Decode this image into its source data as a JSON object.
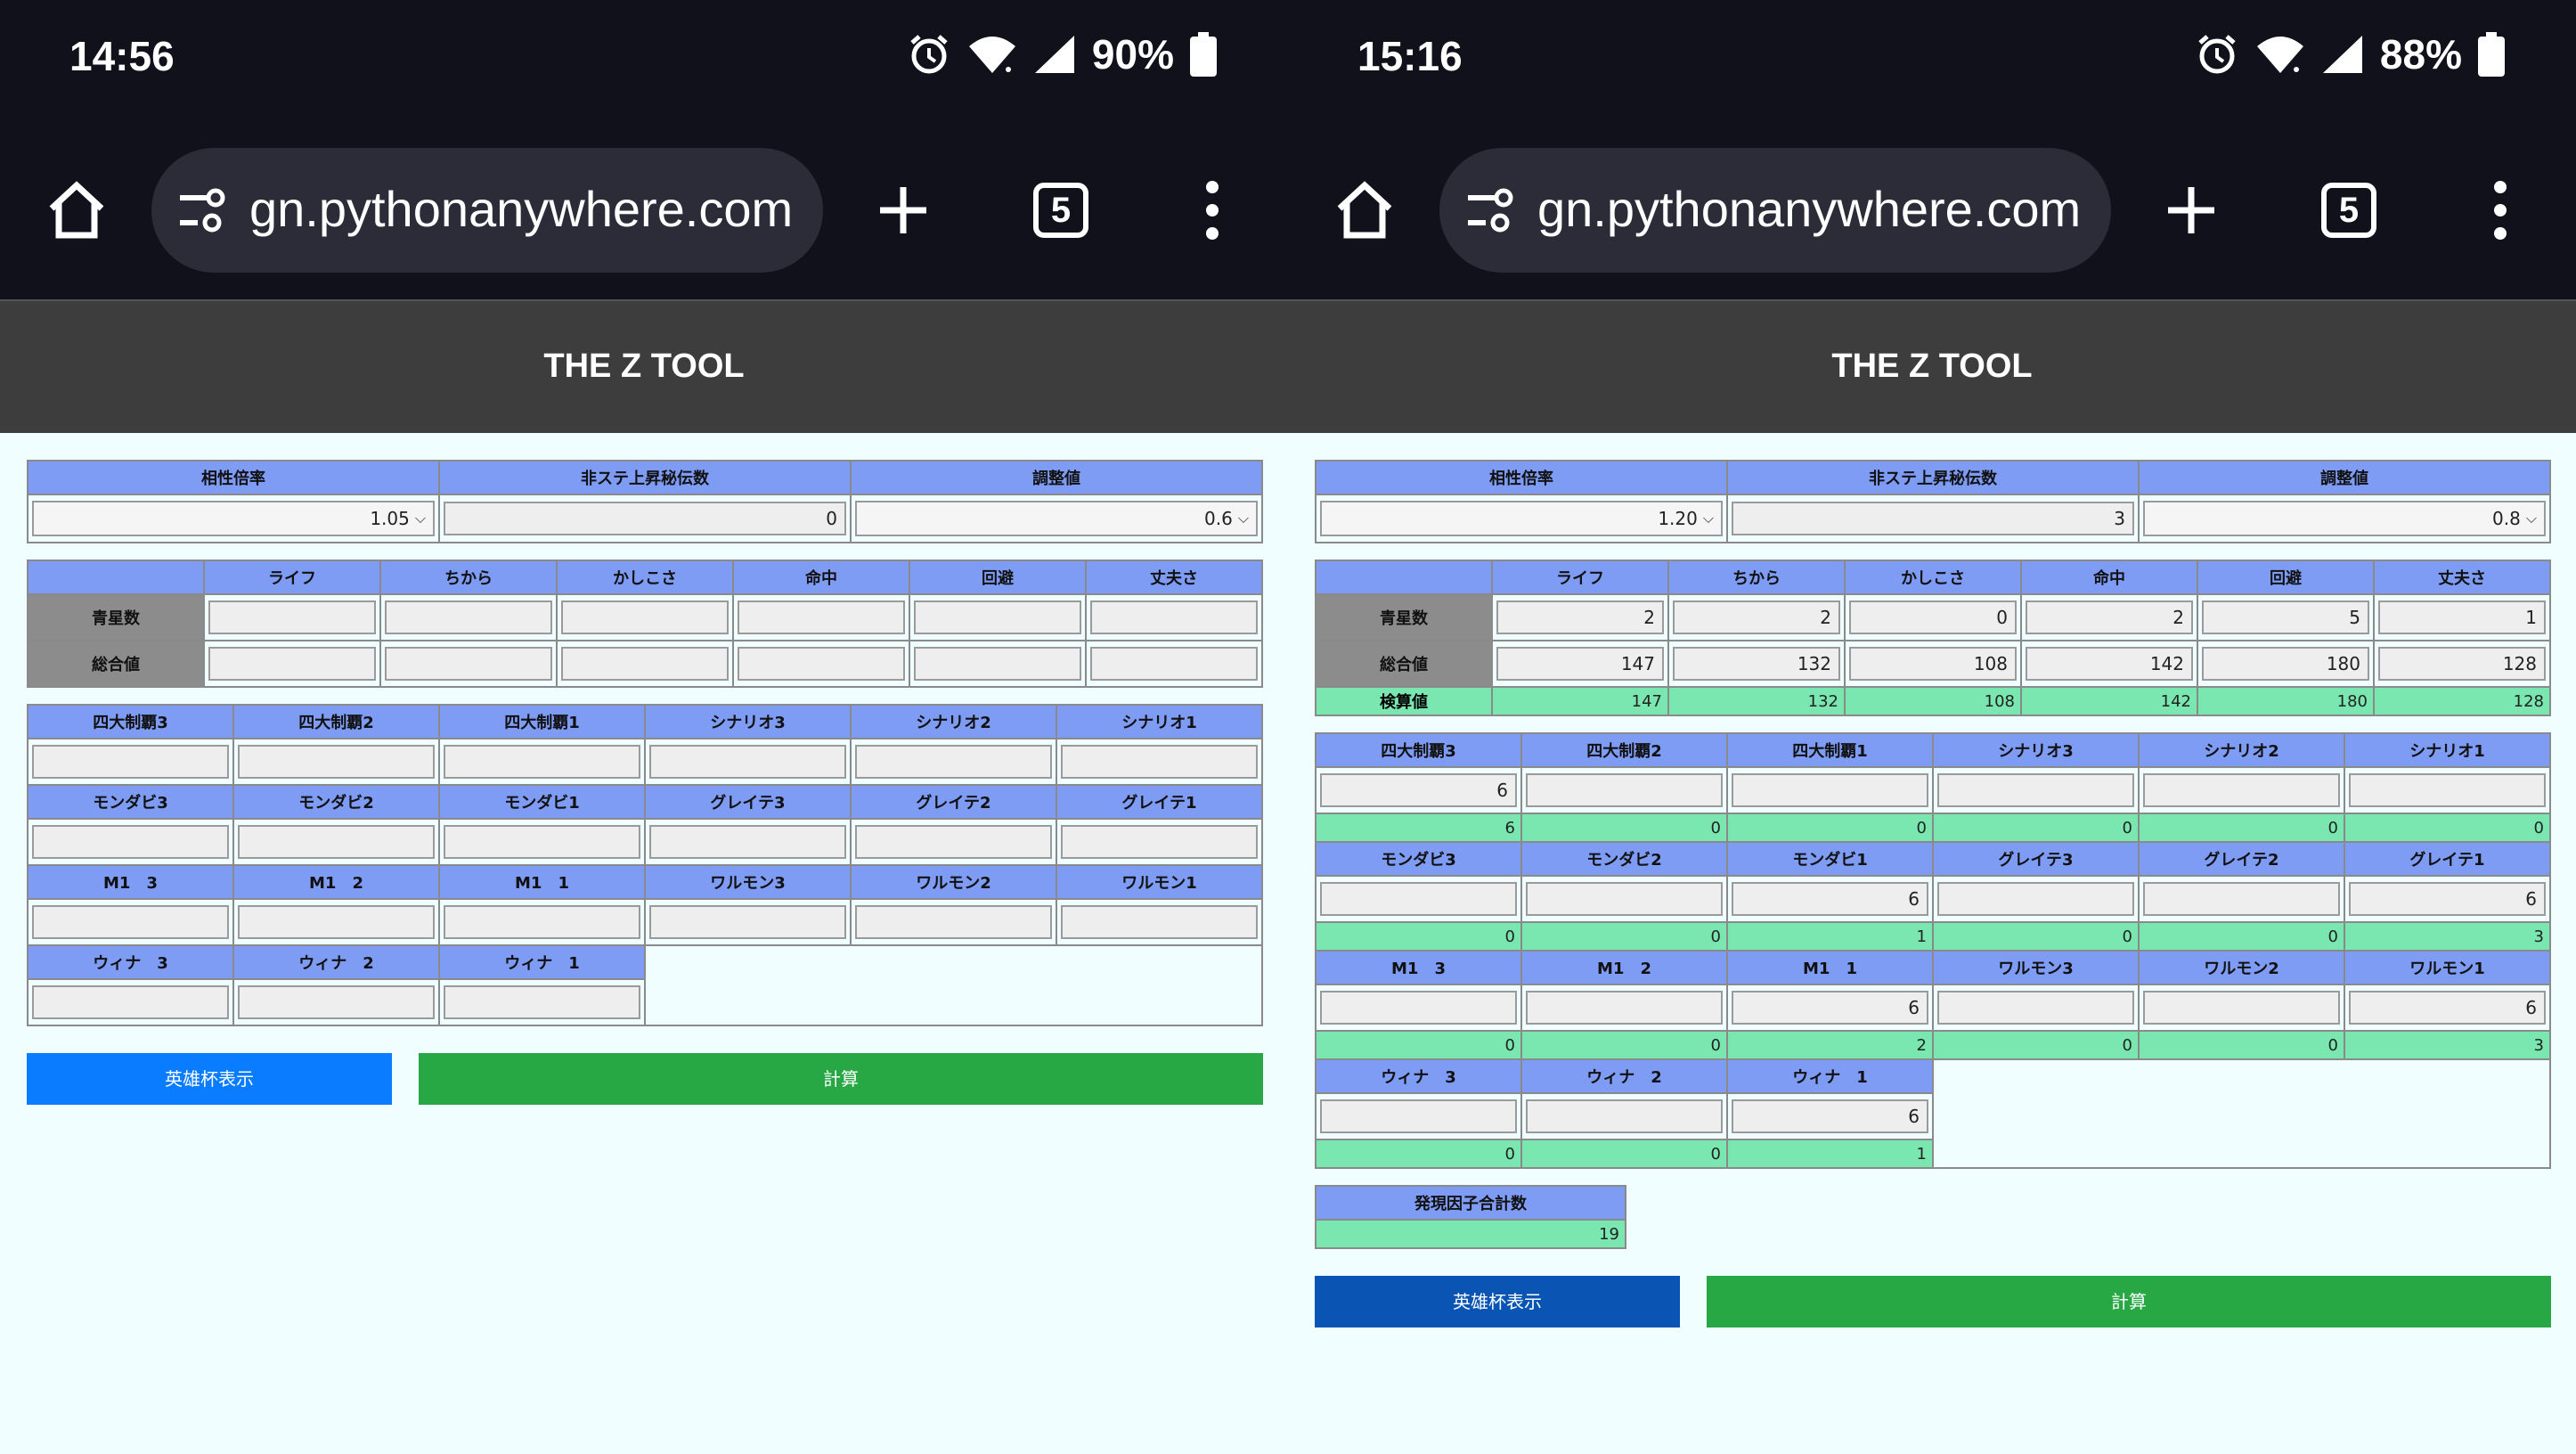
{
  "left": {
    "status": {
      "time": "14:56",
      "battery": "90%"
    },
    "browser": {
      "url": "gn.pythonanywhere.com",
      "tabs": "5"
    },
    "app_title": "THE Z TOOL",
    "top": {
      "headers": [
        "相性倍率",
        "非ステ上昇秘伝数",
        "調整値"
      ],
      "values": [
        "1.05",
        "0",
        "0.6"
      ]
    },
    "stats": {
      "cols": [
        "ライフ",
        "ちから",
        "かしこさ",
        "命中",
        "回避",
        "丈夫さ"
      ],
      "row_labels": [
        "青星数",
        "総合値"
      ]
    },
    "grid": {
      "row1": [
        "四大制覇3",
        "四大制覇2",
        "四大制覇1",
        "シナリオ3",
        "シナリオ2",
        "シナリオ1"
      ],
      "row2": [
        "モンダビ3",
        "モンダビ2",
        "モンダビ1",
        "グレイテ3",
        "グレイテ2",
        "グレイテ1"
      ],
      "row3": [
        "M1　3",
        "M1　2",
        "M1　1",
        "ワルモン3",
        "ワルモン2",
        "ワルモン1"
      ],
      "row4": [
        "ウィナ　3",
        "ウィナ　2",
        "ウィナ　1"
      ]
    },
    "buttons": {
      "hero": "英雄杯表示",
      "calc": "計算"
    }
  },
  "right": {
    "status": {
      "time": "15:16",
      "battery": "88%"
    },
    "browser": {
      "url": "gn.pythonanywhere.com",
      "tabs": "5"
    },
    "app_title": "THE Z TOOL",
    "top": {
      "headers": [
        "相性倍率",
        "非ステ上昇秘伝数",
        "調整値"
      ],
      "values": [
        "1.20",
        "3",
        "0.8"
      ]
    },
    "stats": {
      "cols": [
        "ライフ",
        "ちから",
        "かしこさ",
        "命中",
        "回避",
        "丈夫さ"
      ],
      "row_labels": [
        "青星数",
        "総合値",
        "検算値"
      ],
      "blue_stars": [
        "2",
        "2",
        "0",
        "2",
        "5",
        "1"
      ],
      "totals": [
        "147",
        "132",
        "108",
        "142",
        "180",
        "128"
      ],
      "check": [
        "147",
        "132",
        "108",
        "142",
        "180",
        "128"
      ]
    },
    "grid": {
      "row1": [
        "四大制覇3",
        "四大制覇2",
        "四大制覇1",
        "シナリオ3",
        "シナリオ2",
        "シナリオ1"
      ],
      "row1_inputs": [
        "6",
        "",
        "",
        "",
        "",
        ""
      ],
      "row1_out": [
        "6",
        "0",
        "0",
        "0",
        "0",
        "0"
      ],
      "row2": [
        "モンダビ3",
        "モンダビ2",
        "モンダビ1",
        "グレイテ3",
        "グレイテ2",
        "グレイテ1"
      ],
      "row2_inputs": [
        "",
        "",
        "6",
        "",
        "",
        "6"
      ],
      "row2_out": [
        "0",
        "0",
        "1",
        "0",
        "0",
        "3"
      ],
      "row3": [
        "M1　3",
        "M1　2",
        "M1　1",
        "ワルモン3",
        "ワルモン2",
        "ワルモン1"
      ],
      "row3_inputs": [
        "",
        "",
        "6",
        "",
        "",
        "6"
      ],
      "row3_out": [
        "0",
        "0",
        "2",
        "0",
        "0",
        "3"
      ],
      "row4": [
        "ウィナ　3",
        "ウィナ　2",
        "ウィナ　1"
      ],
      "row4_inputs": [
        "",
        "",
        "6"
      ],
      "row4_out": [
        "0",
        "0",
        "1"
      ]
    },
    "summary": {
      "label": "発現因子合計数",
      "value": "19"
    },
    "buttons": {
      "hero": "英雄杯表示",
      "calc": "計算"
    }
  }
}
